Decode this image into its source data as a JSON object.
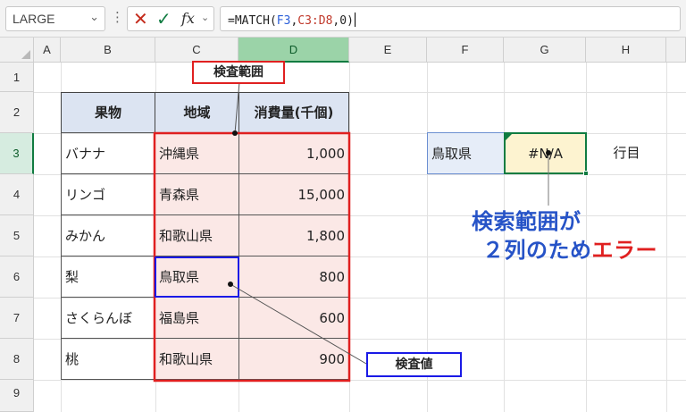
{
  "formula_bar": {
    "name_box": "LARGE",
    "formula_prefix": "=MATCH(",
    "formula_ref1": "F3",
    "formula_sep1": ",",
    "formula_ref2": "C3:D8",
    "formula_suffix": ",0)"
  },
  "columns": [
    "A",
    "B",
    "C",
    "D",
    "E",
    "F",
    "G",
    "H"
  ],
  "active_column": "D",
  "rows": [
    "1",
    "2",
    "3",
    "4",
    "5",
    "6",
    "7",
    "8",
    "9"
  ],
  "active_row": "3",
  "table": {
    "headers": [
      "果物",
      "地域",
      "消費量(千個)"
    ],
    "rows": [
      {
        "fruit": "バナナ",
        "region": "沖縄県",
        "amount": "1,000"
      },
      {
        "fruit": "リンゴ",
        "region": "青森県",
        "amount": "15,000"
      },
      {
        "fruit": "みかん",
        "region": "和歌山県",
        "amount": "1,800"
      },
      {
        "fruit": "梨",
        "region": "鳥取県",
        "amount": "800"
      },
      {
        "fruit": "さくらんぼ",
        "region": "福島県",
        "amount": "600"
      },
      {
        "fruit": "桃",
        "region": "和歌山県",
        "amount": "900"
      }
    ]
  },
  "lookup": {
    "value_cell": "鳥取県",
    "result_cell": "#N/A",
    "h3_text": "行目"
  },
  "annotations": {
    "range_label": "検査範囲",
    "value_label": "検査値",
    "error_note_line1": "検索範囲が",
    "error_note_line2_prefix": "２列のため",
    "error_note_line2_error": "エラー"
  },
  "colors": {
    "range_border": "#e02020",
    "value_border": "#1a1ae6",
    "note_blue": "#2653c7",
    "error_red": "#e02020",
    "table_header_fill": "#dce4f2",
    "range_fill": "#fbe8e6",
    "result_fill": "#fdf3d0",
    "lookup_fill": "#e6edf8",
    "excel_green": "#107c41"
  }
}
